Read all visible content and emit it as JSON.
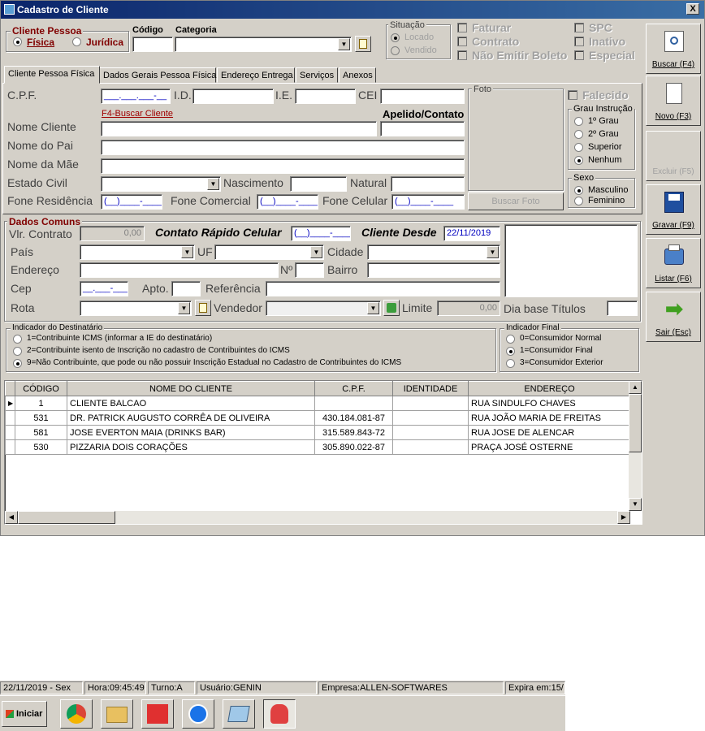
{
  "window": {
    "title": "Cadastro de Cliente",
    "close": "X"
  },
  "tipo_pessoa": {
    "label": "Cliente Pessoa",
    "fisica": "Física",
    "juridica": "Jurídica"
  },
  "codigo_label": "Código",
  "categoria_label": "Categoria",
  "situacao": {
    "label": "Situação",
    "locado": "Locado",
    "vendido": "Vendido"
  },
  "flags": {
    "faturar": "Faturar",
    "contrato": "Contrato",
    "nao_emitir_boleto": "Não Emitir Boleto",
    "spc": "SPC",
    "inativo": "Inativo",
    "especial": "Especial"
  },
  "tabs": [
    "Cliente Pessoa Física",
    "Dados Gerais Pessoa Física",
    "Endereço Entrega",
    "Serviços",
    "Anexos"
  ],
  "pf": {
    "cpf_label": "C.P.F.",
    "cpf_mask": "___.___.___-__",
    "id_label": "I.D.",
    "ie_label": "I.E.",
    "cei_label": "CEI",
    "buscar_link": "F4-Buscar Cliente",
    "apelido_label": "Apelido/Contato",
    "nome_cliente": "Nome Cliente",
    "nome_pai": "Nome do Pai",
    "nome_mae": "Nome da Mãe",
    "estado_civil": "Estado Civil",
    "nascimento": "Nascimento",
    "natural": "Natural",
    "fone_residencia": "Fone Residência",
    "fone_comercial": "Fone Comercial",
    "fone_celular": "Fone Celular",
    "phone_mask": "(__)____-____",
    "foto_label": "Foto",
    "buscar_foto": "Buscar Foto",
    "falecido": "Falecido",
    "grau_label": "Grau Instrução",
    "grau": [
      "1º Grau",
      "2º Grau",
      "Superior",
      "Nenhum"
    ],
    "sexo_label": "Sexo",
    "sexo": [
      "Masculino",
      "Feminino"
    ]
  },
  "comuns": {
    "title": "Dados Comuns",
    "vlr_contrato": "Vlr. Contrato",
    "vlr_value": "0,00",
    "contato_rapido": "Contato Rápido Celular",
    "phone_mask": "(__)____-____",
    "cliente_desde": "Cliente Desde",
    "cliente_desde_value": "22/11/2019",
    "pais": "País",
    "uf": "UF",
    "cidade": "Cidade",
    "endereco": "Endereço",
    "numero": "Nº",
    "bairro": "Bairro",
    "cep": "Cep",
    "cep_mask": "__.___-___",
    "apto": "Apto.",
    "referencia": "Referência",
    "rota": "Rota",
    "vendedor": "Vendedor",
    "limite": "Limite",
    "limite_value": "0,00",
    "dia_base": "Dia base Títulos"
  },
  "destinatario": {
    "label": "Indicador do Destinatário",
    "options": [
      "1=Contribuinte ICMS (informar a IE do destinatário)",
      "2=Contribuinte isento de Inscrição no cadastro de Contribuintes do ICMS",
      "9=Não Contribuinte, que pode ou não possuir Inscrição Estadual no Cadastro de Contribuintes do ICMS"
    ]
  },
  "indicador_final": {
    "label": "Indicador Final",
    "options": [
      "0=Consumidor Normal",
      "1=Consumidor Final",
      "3=Consumidor Exterior"
    ]
  },
  "grid": {
    "headers": [
      "CÓDIGO",
      "NOME DO CLIENTE",
      "C.P.F.",
      "IDENTIDADE",
      "ENDEREÇO"
    ],
    "rows": [
      [
        "1",
        "CLIENTE BALCAO",
        "",
        "",
        "RUA SINDULFO CHAVES"
      ],
      [
        "531",
        "DR. PATRICK AUGUSTO CORRÊA DE OLIVEIRA",
        "430.184.081-87",
        "",
        "RUA JOÃO MARIA DE FREITAS"
      ],
      [
        "581",
        "JOSE EVERTON MAIA (DRINKS BAR)",
        "315.589.843-72",
        "",
        "RUA JOSE DE ALENCAR"
      ],
      [
        "530",
        "PIZZARIA DOIS CORAÇÕES",
        "305.890.022-87",
        "",
        "PRAÇA JOSÉ OSTERNE"
      ]
    ]
  },
  "sidebar": {
    "buscar": "Buscar (F4)",
    "novo": "Novo (F3)",
    "excluir": "Excluir (F5)",
    "gravar": "Gravar (F9)",
    "listar": "Listar (F6)",
    "sair": "Sair (Esc)"
  },
  "status": {
    "date": "22/11/2019 - Sex",
    "hora": "Hora:09:45:49",
    "turno": "Turno:A",
    "usuario": "Usuário:GENIN",
    "empresa": "Empresa:ALLEN-SOFTWARES",
    "expira": "Expira em:15/"
  },
  "taskbar": {
    "start": "Iniciar"
  }
}
